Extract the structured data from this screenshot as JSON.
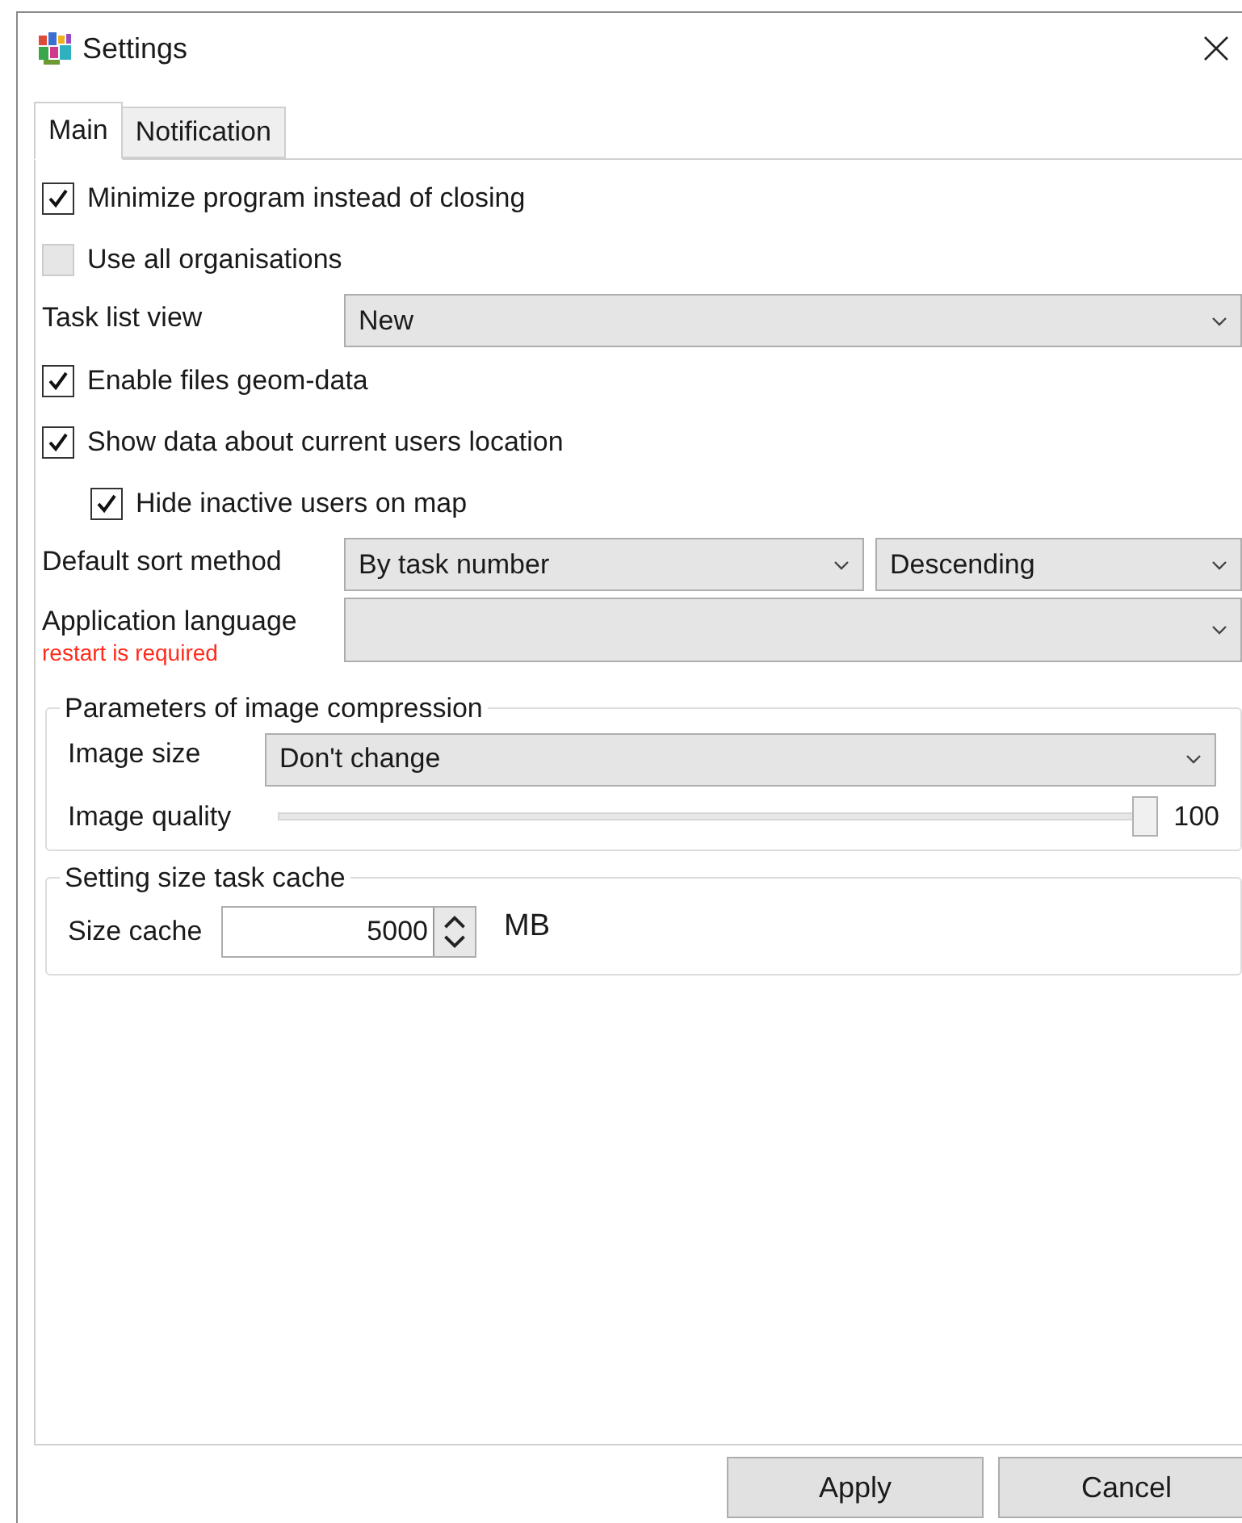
{
  "window": {
    "title": "Settings"
  },
  "tabs": [
    {
      "label": "Main",
      "selected": true
    },
    {
      "label": "Notification",
      "selected": false
    }
  ],
  "rows": [
    {
      "kind": "checkbox",
      "label": "Minimize program instead of closing",
      "checked": true,
      "disabled": false
    },
    {
      "kind": "checkbox",
      "label": "Use all organisations",
      "checked": false,
      "disabled": true
    },
    {
      "kind": "select",
      "label": "Task list view",
      "selects": [
        {
          "value": "New"
        }
      ]
    },
    {
      "kind": "checkbox",
      "label": "Enable files geom-data",
      "checked": true,
      "disabled": false
    },
    {
      "kind": "checkbox",
      "label": "Show data about current users location",
      "checked": true,
      "disabled": false,
      "children": [
        {
          "kind": "checkbox",
          "label": "Hide inactive users on map",
          "checked": true,
          "disabled": false
        }
      ]
    },
    {
      "kind": "select",
      "label": "Default sort method",
      "selects": [
        {
          "value": "By task number"
        },
        {
          "value": "Descending"
        }
      ]
    },
    {
      "kind": "select",
      "label": "Application language",
      "note": "restart is required"
    }
  ],
  "image_compression": {
    "title": "Parameters of image compression",
    "image_size": {
      "label": "Image size",
      "value": "Don't change"
    },
    "image_quality": {
      "label": "Image quality",
      "level": 1,
      "reading": "100"
    }
  },
  "task_cache": {
    "title": "Setting size task cache",
    "label": "Size cache",
    "value": "5000",
    "unit": "MB"
  },
  "buttons": [
    {
      "label": "Apply"
    },
    {
      "label": "Cancel"
    }
  ]
}
